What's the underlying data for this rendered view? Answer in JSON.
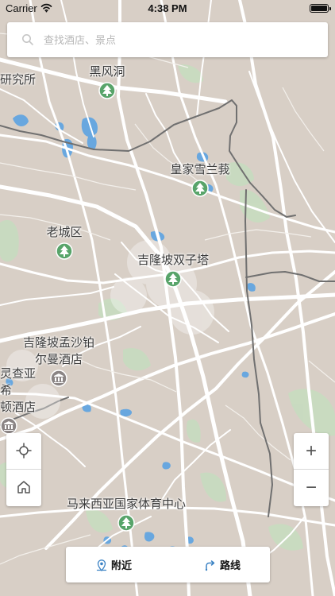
{
  "status_bar": {
    "carrier": "Carrier",
    "time": "4:38 PM",
    "signal_icon": "wifi-icon",
    "battery_icon": "battery-icon"
  },
  "search": {
    "placeholder": "查找酒店、景点",
    "icon": "search-icon"
  },
  "map": {
    "background_color": "#d8cfc6",
    "road_color": "#ffffff",
    "railway_color": "#707070",
    "water_color": "#68a7df",
    "park_color": "#c8dbc0",
    "labels": {
      "research": "研究所",
      "black_wind_cave": "黑风洞",
      "royal_selangor": "皇家雪兰莪",
      "old_town": "老城区",
      "twin_towers": "吉隆坡双子塔",
      "pullman": "吉隆坡孟沙铂\n尔曼酒店",
      "kl_hotel": "灵查亚希\n顿酒店",
      "stadium": "马来西亚国家体育中心"
    }
  },
  "controls": {
    "locate_icon": "locate-icon",
    "home_icon": "home-icon",
    "zoom_in": "+",
    "zoom_out": "−"
  },
  "bottom_nav": {
    "nearby": "附近",
    "route": "路线",
    "nearby_icon": "map-pin-icon",
    "route_icon": "route-icon"
  }
}
